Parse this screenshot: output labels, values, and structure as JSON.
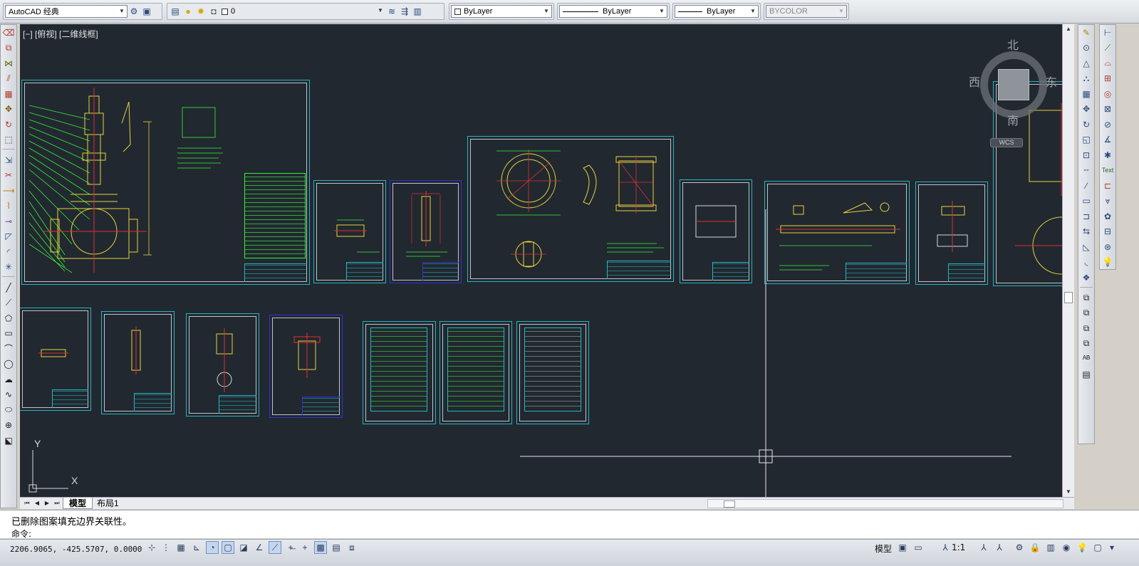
{
  "toolbar": {
    "workspace": "AutoCAD 经典",
    "layer_name": "0",
    "color": "ByLayer",
    "linetype": "ByLayer",
    "lineweight": "ByLayer",
    "plotstyle": "BYCOLOR"
  },
  "viewport": {
    "label": "[−] [俯视] [二维线框]"
  },
  "viewcube": {
    "north": "北",
    "south": "南",
    "east": "东",
    "west": "西",
    "wcs": "WCS"
  },
  "ucs": {
    "x": "X",
    "y": "Y"
  },
  "tabs": [
    {
      "label": "模型",
      "active": true
    },
    {
      "label": "布局1",
      "active": false
    }
  ],
  "command": {
    "history": "已删除图案填充边界关联性。",
    "prompt": "命令:"
  },
  "status": {
    "coordinates": "2206.9065,  -425.5707,  0.0000",
    "model_label": "模型",
    "annotation_scale": "1:1"
  },
  "colors": {
    "canvas": "#212830",
    "sheet_border": "#27b5c1",
    "sheet_border_alt": "#3232d8",
    "geometry_green": "#39f039",
    "geometry_yellow": "#e8d23a",
    "geometry_red": "#e03030"
  },
  "icons": {
    "left_strip": [
      "erase-icon",
      "copy-icon",
      "mirror-icon",
      "offset-icon",
      "array-icon",
      "move-icon",
      "rotate-icon",
      "scale-icon",
      "stretch-icon",
      "trim-icon",
      "extend-icon",
      "break-icon",
      "join-icon",
      "chamfer-icon",
      "fillet-icon",
      "explode-icon",
      "line-icon",
      "polyline-icon",
      "polygon-icon",
      "rectangle-icon",
      "arc-icon",
      "circle-icon",
      "revcloud-icon",
      "spline-icon",
      "ellipse-icon",
      "insert-block-icon",
      "make-block-icon"
    ],
    "right_strip": [
      "linear-dim-icon",
      "aligned-dim-icon",
      "arc-length-icon",
      "ordinate-icon",
      "radius-icon",
      "jogged-icon",
      "diameter-icon",
      "angular-icon",
      "quick-dim-icon",
      "baseline-icon",
      "continue-icon",
      "leader-icon",
      "tolerance-icon",
      "center-mark-icon",
      "text-icon"
    ]
  }
}
